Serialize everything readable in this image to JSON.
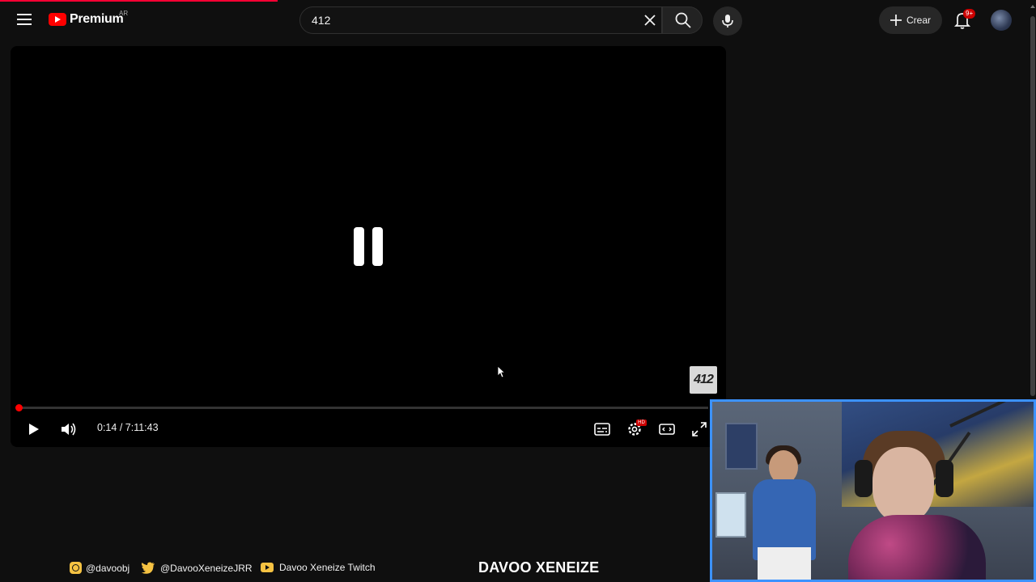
{
  "masthead": {
    "logo_text": "Premium",
    "country_code": "AR",
    "search_value": "412",
    "create_label": "Crear",
    "notification_count": "9+"
  },
  "player": {
    "watermark_text": "412",
    "time_current": "0:14",
    "time_separator": " / ",
    "time_total": "7:11:43",
    "progress_fraction": 0.00054,
    "settings_badge": "HD"
  },
  "footer": {
    "instagram": "@davoobj",
    "twitter": "@DavooXeneizeJRR",
    "youtube": "Davoo Xeneize Twitch",
    "streamer_name": "DAVOO XENEIZE"
  },
  "colors": {
    "accent_red": "#ff0000",
    "webcam_border": "#3c92ff",
    "footer_icon": "#f5c242"
  }
}
